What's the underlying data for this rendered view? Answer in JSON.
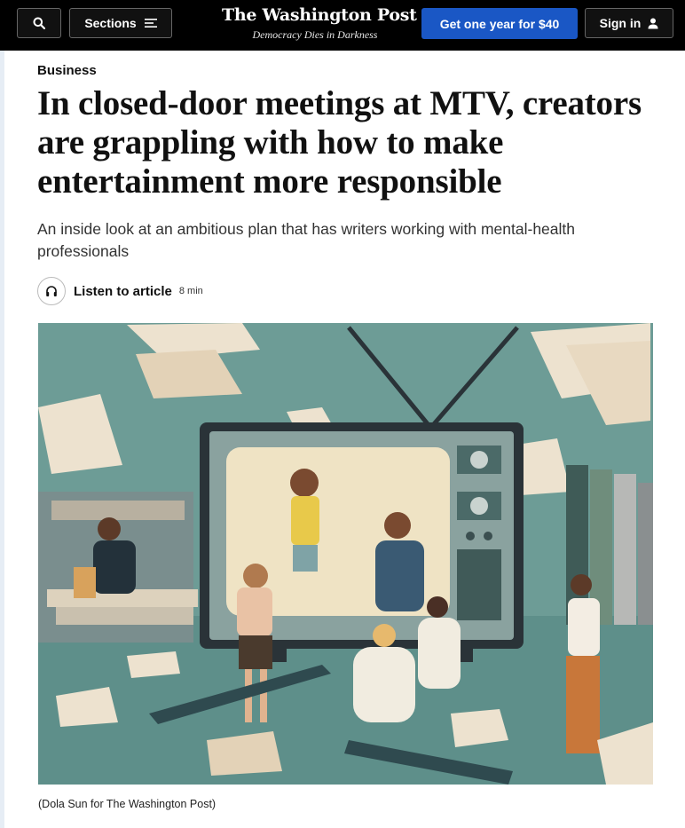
{
  "topbar": {
    "sections_label": "Sections",
    "masthead_title": "The Washington Post",
    "masthead_tagline": "Democracy Dies in Darkness",
    "subscribe_label": "Get one year for $40",
    "signin_label": "Sign in"
  },
  "article": {
    "kicker": "Business",
    "headline": "In closed-door meetings at MTV, creators are grappling with how to make entertainment more responsible",
    "subheadline": "An inside look at an ambitious plan that has writers working with mental-health professionals",
    "listen_label": "Listen to article",
    "listen_duration": "8 min",
    "image_caption": "(Dola Sun for The Washington Post)"
  },
  "colors": {
    "topbar_bg": "#000000",
    "subscribe_bg": "#1a57c5",
    "illustration_bg": "#6d9c96"
  },
  "icons": [
    "search-icon",
    "hamburger-icon",
    "user-icon",
    "headphones-icon"
  ]
}
